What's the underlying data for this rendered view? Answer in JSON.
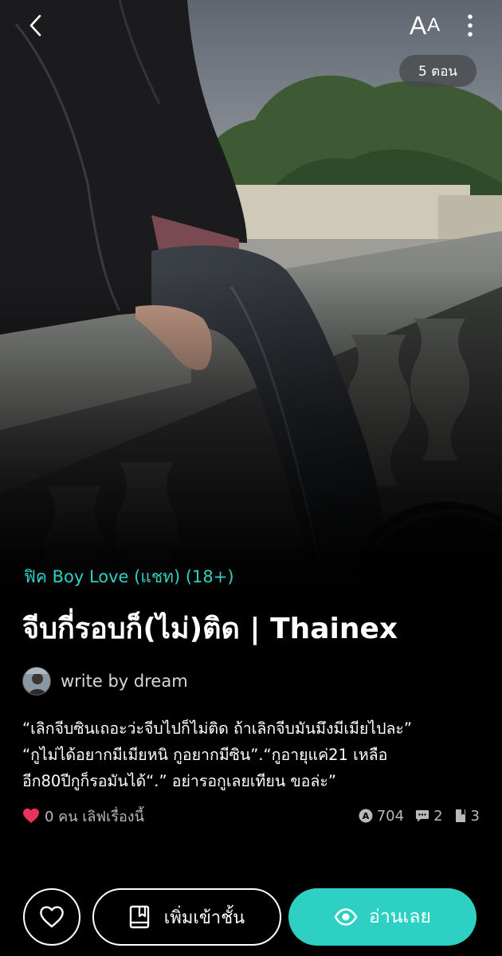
{
  "header": {
    "back_icon": "chevron-left-icon",
    "font_size_label_big": "A",
    "font_size_label_small": "A",
    "menu_icon": "more-vertical-icon",
    "episodes_label": "5 ตอน"
  },
  "story": {
    "category": "ฟิค Boy Love (แชท) (18+)",
    "title": "จีบกี่รอบก็(ไม่)ติด | Thainex",
    "author": "write by dream",
    "synopsis_lines": [
      "“เลิกจีบซินเถอะว่ะจีบไปก็ไม่ติด ถ้าเลิกจีบมันมึงมีเมียไปละ”",
      "“กูไม่ได้อยากมีเมียหนิ กูอยากมีซิน”.“กูอายุแค่21 เหลือ",
      "อีก80ปีกูก็รอมันได้“.” อย่ารอกูเลยเทียน ขอล่ะ”"
    ]
  },
  "stats": {
    "likes_label": "0 คน เลิฟเรื่องนี้",
    "views": "704",
    "comments": "2",
    "chapters": "3"
  },
  "actions": {
    "shelf_label": "เพิ่มเข้าชั้น",
    "read_label": "อ่านเลย"
  },
  "colors": {
    "accent": "#2fd0c4",
    "heart": "#e8345a",
    "background": "#000000"
  }
}
